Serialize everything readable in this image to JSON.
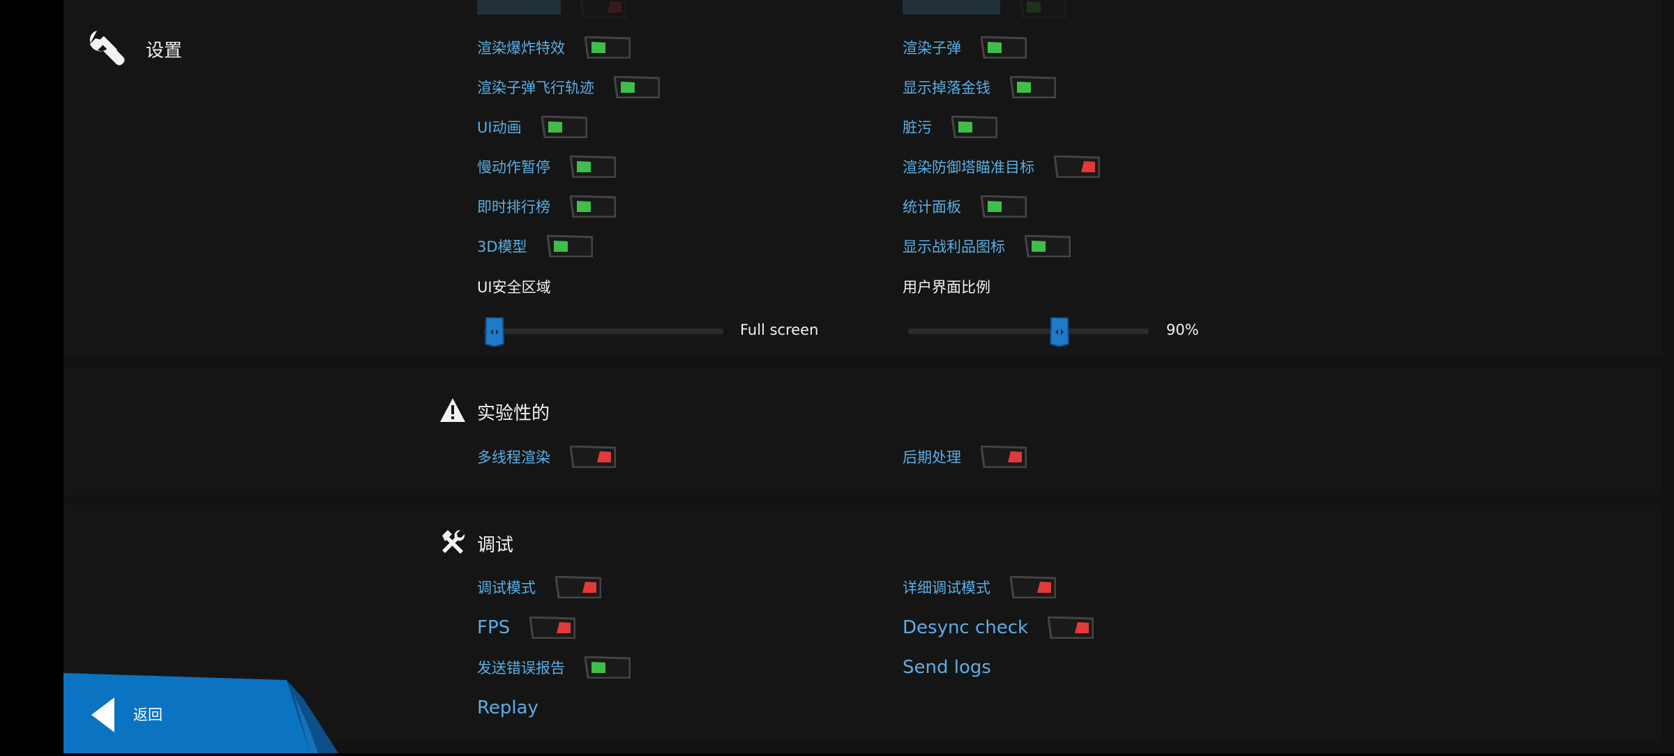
{
  "header": {
    "title": "设置"
  },
  "display": {
    "left_options": [
      {
        "label": "渲染爆炸特效",
        "on": true
      },
      {
        "label": "渲染子弹飞行轨迹",
        "on": true
      },
      {
        "label": "UI动画",
        "on": true
      },
      {
        "label": "慢动作暂停",
        "on": true
      },
      {
        "label": "即时排行榜",
        "on": true
      },
      {
        "label": "3D模型",
        "on": true
      }
    ],
    "right_options": [
      {
        "label": "渲染子弹",
        "on": true
      },
      {
        "label": "显示掉落金钱",
        "on": true
      },
      {
        "label": "脏污",
        "on": true
      },
      {
        "label": "渲染防御塔瞄准目标",
        "on": false
      },
      {
        "label": "统计面板",
        "on": true
      },
      {
        "label": "显示战利品图标",
        "on": true
      }
    ],
    "safe_area": {
      "label": "UI安全区域",
      "value_text": "Full screen",
      "fraction": 0.0
    },
    "ui_scale": {
      "label": "用户界面比例",
      "value_text": "90%",
      "fraction": 0.64
    }
  },
  "experimental": {
    "title": "实验性的",
    "options": [
      {
        "label": "多线程渲染",
        "on": false
      },
      {
        "label": "后期处理",
        "on": false
      }
    ]
  },
  "debug": {
    "title": "调试",
    "options": [
      {
        "label": "调试模式",
        "on": false
      },
      {
        "label": "详细调试模式",
        "on": false
      },
      {
        "label": "FPS",
        "on": false
      },
      {
        "label": "Desync check",
        "on": false
      },
      {
        "label": "发送错误报告",
        "on": true
      }
    ],
    "send_logs": "Send logs",
    "replay": "Replay"
  },
  "footer": {
    "back_label": "返回"
  },
  "colors": {
    "on": "#3fbf4a",
    "off": "#e23a3a",
    "accent": "#0a73c2",
    "label": "#5aaee6"
  }
}
